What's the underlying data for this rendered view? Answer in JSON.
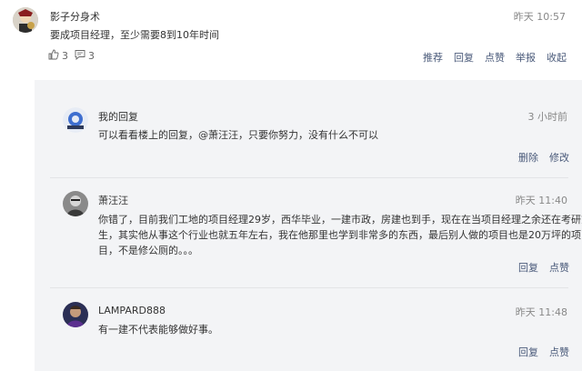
{
  "main_comment": {
    "username": "影子分身术",
    "time": "昨天 10:57",
    "text": "要成项目经理，至少需要8到10年时间",
    "likes": "3",
    "comments": "3",
    "actions": [
      "推荐",
      "回复",
      "点赞",
      "举报",
      "收起"
    ]
  },
  "replies": [
    {
      "username": "我的回复",
      "time": "3 小时前",
      "text": "可以看看楼上的回复，@萧汪汪，只要你努力，没有什么不可以",
      "actions": [
        "删除",
        "修改"
      ]
    },
    {
      "username": "萧汪汪",
      "time": "昨天 11:40",
      "text_lines": [
        "你错了，目前我们工地的项目经理29岁，西华毕业，一建市政，房建也到手，现在在当项目经理之余还在考研究",
        "生，其实他从事这个行业也就五年左右，我在他那里也学到非常多的东西，最后别人做的项目也是20万坪的项",
        "目，不是修公厕的。。。"
      ],
      "actions": [
        "回复",
        "点赞"
      ]
    },
    {
      "username": "LAMPARD888",
      "time": "昨天 11:48",
      "text": "有一建不代表能够做好事。",
      "actions": [
        "回复",
        "点赞"
      ]
    }
  ]
}
